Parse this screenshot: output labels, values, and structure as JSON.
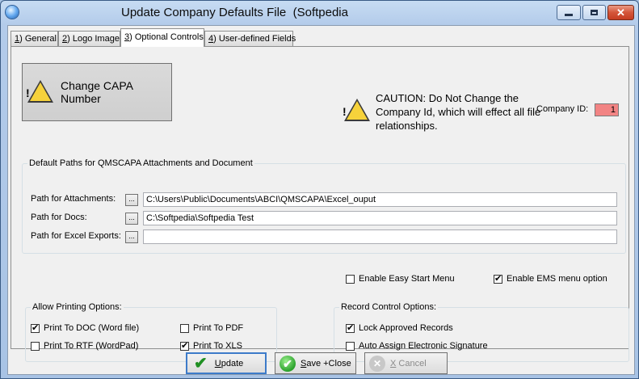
{
  "window": {
    "title": "Update Company Defaults File  (Softpedia",
    "minimize_glyph": "",
    "close_glyph": "✕"
  },
  "tabs": [
    {
      "key": "1",
      "label": ") General"
    },
    {
      "key": "2",
      "label": ") Logo Image"
    },
    {
      "key": "3",
      "label": ") Optional Controls"
    },
    {
      "key": "4",
      "label": ") User-defined Fields"
    }
  ],
  "change_capa_button": "Change CAPA Number",
  "caution_text": "CAUTION: Do Not Change the Company Id, which will effect all file relationships.",
  "company_id": {
    "label": "Company ID:",
    "value": "1"
  },
  "paths_group": {
    "legend": "Default Paths for QMSCAPA Attachments and Document",
    "browse_label": "...",
    "rows": [
      {
        "label": "Path for Attachments:",
        "value": "C:\\Users\\Public\\Documents\\ABCI\\QMSCAPA\\Excel_ouput"
      },
      {
        "label": "Path for Docs:",
        "value": "C:\\Softpedia\\Softpedia Test"
      },
      {
        "label": "Path for Excel Exports:",
        "value": ""
      }
    ]
  },
  "options": {
    "easy_start": {
      "label": "Enable Easy Start Menu",
      "checked": false
    },
    "ems_menu": {
      "label": "Enable EMS menu option",
      "checked": true
    }
  },
  "printing_group": {
    "legend": "Allow Printing Options:",
    "items": [
      {
        "label": "Print To DOC (Word file)",
        "checked": true
      },
      {
        "label": "Print To PDF",
        "checked": false
      },
      {
        "label": "Print To RTF (WordPad)",
        "checked": false
      },
      {
        "label": "Print To XLS",
        "checked": true
      }
    ]
  },
  "record_group": {
    "legend": "Record Control Options:",
    "items": [
      {
        "label": "Lock Approved Records",
        "checked": true
      },
      {
        "label": "Auto Assign Electronic Signature",
        "checked": false
      }
    ]
  },
  "buttons": {
    "update": {
      "mnemonic": "U",
      "rest": "pdate"
    },
    "save_close": {
      "mnemonic": "S",
      "rest": "ave +Close"
    },
    "cancel": {
      "mnemonic": "X",
      "rest": " Cancel"
    }
  }
}
